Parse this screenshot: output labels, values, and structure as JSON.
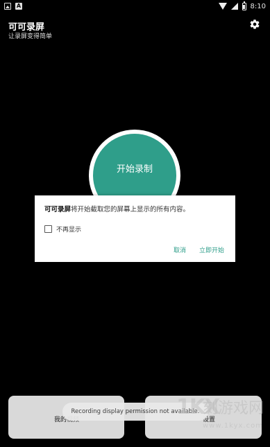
{
  "status_bar": {
    "time": "8:10"
  },
  "app": {
    "title": "可可录屏",
    "subtitle": "让录屏变得简单"
  },
  "record_button": {
    "label": "开始录制"
  },
  "dialog": {
    "app_name": "可可录屏",
    "message": "将开始截取您的屏幕上显示的所有内容。",
    "checkbox_label": "不再显示",
    "cancel_label": "取消",
    "start_label": "立即开始"
  },
  "bottom": {
    "left_label": "我的视频",
    "right_label": "设置"
  },
  "toast": {
    "text": "Recording display permission not available."
  },
  "watermark": {
    "logo": "1KX",
    "text": "刻游戏网",
    "url": "www.1kyx.com"
  },
  "colors": {
    "accent": "#2f9e8a",
    "background": "#000000",
    "dialog": "#ffffff"
  }
}
